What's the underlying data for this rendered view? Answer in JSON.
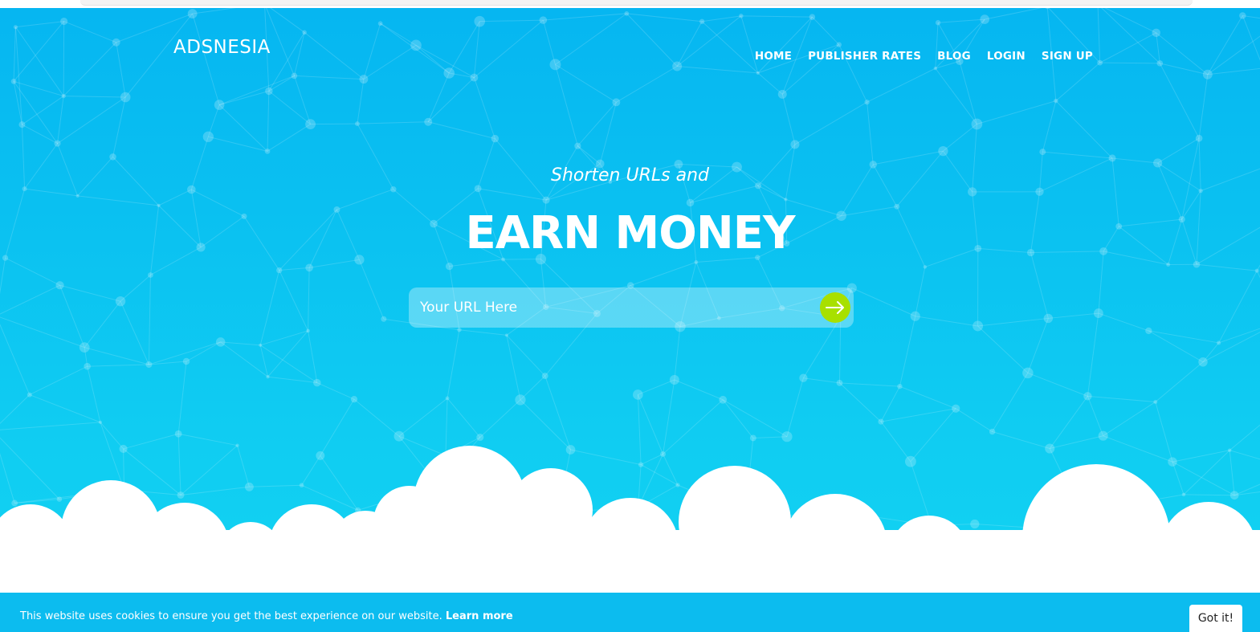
{
  "brand": {
    "logo_text": "ADSNESIA"
  },
  "nav": {
    "items": [
      {
        "label": "HOME"
      },
      {
        "label": "PUBLISHER RATES"
      },
      {
        "label": "BLOG"
      },
      {
        "label": "LOGIN"
      },
      {
        "label": "SIGN UP"
      }
    ]
  },
  "hero": {
    "tagline": "Shorten URLs and",
    "headline": "EARN MONEY",
    "url_input": {
      "placeholder": "Your URL Here",
      "value": ""
    },
    "submit_icon": "arrow-right-icon"
  },
  "cookie_banner": {
    "message": "This website uses cookies to ensure you get the best experience on our website.",
    "link_label": "Learn more",
    "button_label": "Got it!"
  },
  "colors": {
    "hero_top": "#06b6f1",
    "hero_bottom": "#12d2f2",
    "submit_button": "#a8e000",
    "cookie_bar": "#0cbcef"
  }
}
